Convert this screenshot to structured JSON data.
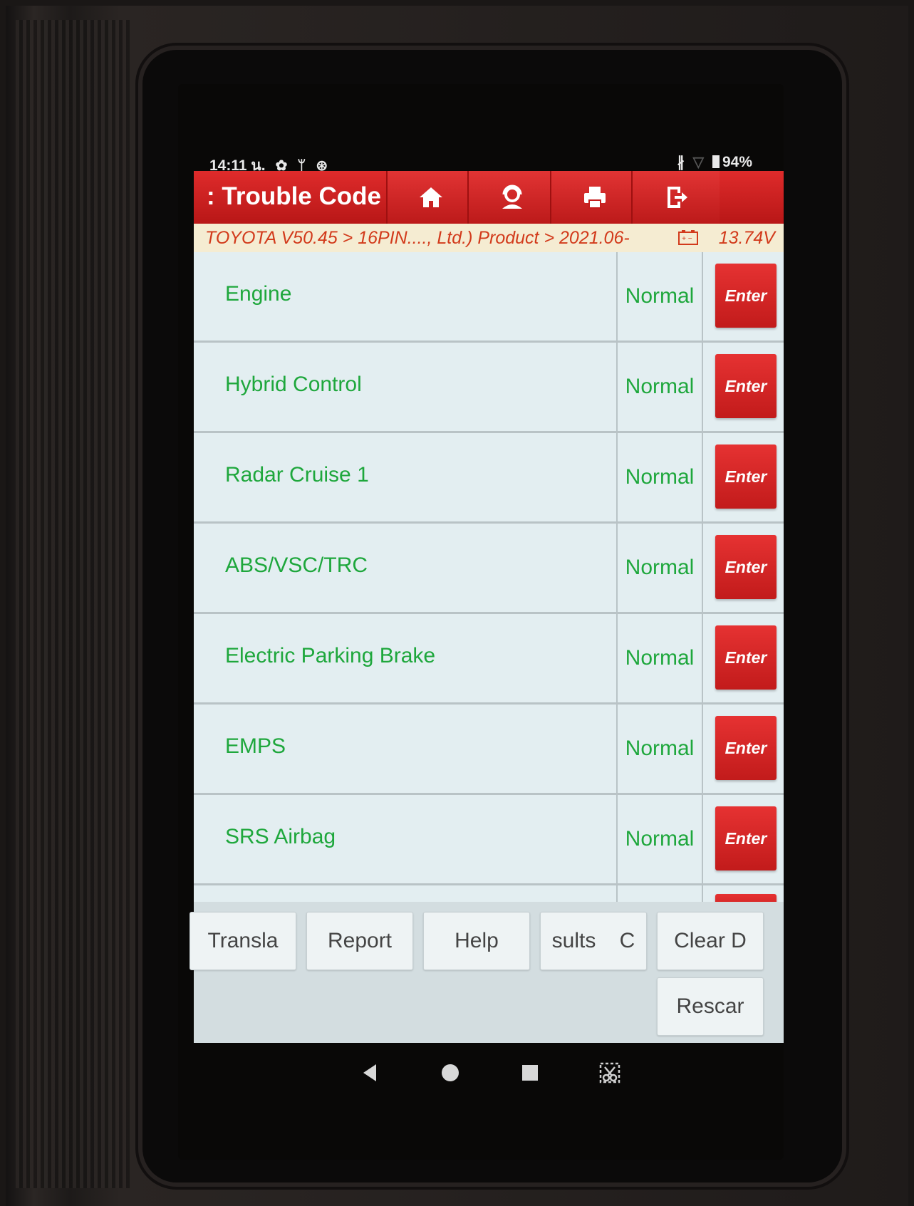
{
  "statusbar": {
    "time": "14:11 น.",
    "battery": "94%"
  },
  "header": {
    "title": ": Trouble Code",
    "icons": [
      "home-icon",
      "support-icon",
      "print-icon",
      "exit-icon"
    ]
  },
  "breadcrumb": {
    "path": "TOYOTA V50.45 > 16PIN...., Ltd.) Product > 2021.06-",
    "voltage": "13.74V"
  },
  "systems": [
    {
      "name": "Engine",
      "status": "Normal",
      "action": "Enter"
    },
    {
      "name": "Hybrid Control",
      "status": "Normal",
      "action": "Enter"
    },
    {
      "name": "Radar Cruise 1",
      "status": "Normal",
      "action": "Enter"
    },
    {
      "name": "ABS/VSC/TRC",
      "status": "Normal",
      "action": "Enter"
    },
    {
      "name": "Electric Parking Brake",
      "status": "Normal",
      "action": "Enter"
    },
    {
      "name": "EMPS",
      "status": "Normal",
      "action": "Enter"
    },
    {
      "name": "SRS Airbag",
      "status": "Normal",
      "action": "Enter"
    }
  ],
  "toolbar": {
    "translate": "Transla",
    "report": "Report",
    "help": "Help",
    "results": "sults    C",
    "clear": "Clear D",
    "rescan": "Rescar"
  },
  "colors": {
    "accent_red": "#d32222",
    "status_green": "#1ea73c",
    "breadcrumb_orange": "#d23a1b"
  }
}
